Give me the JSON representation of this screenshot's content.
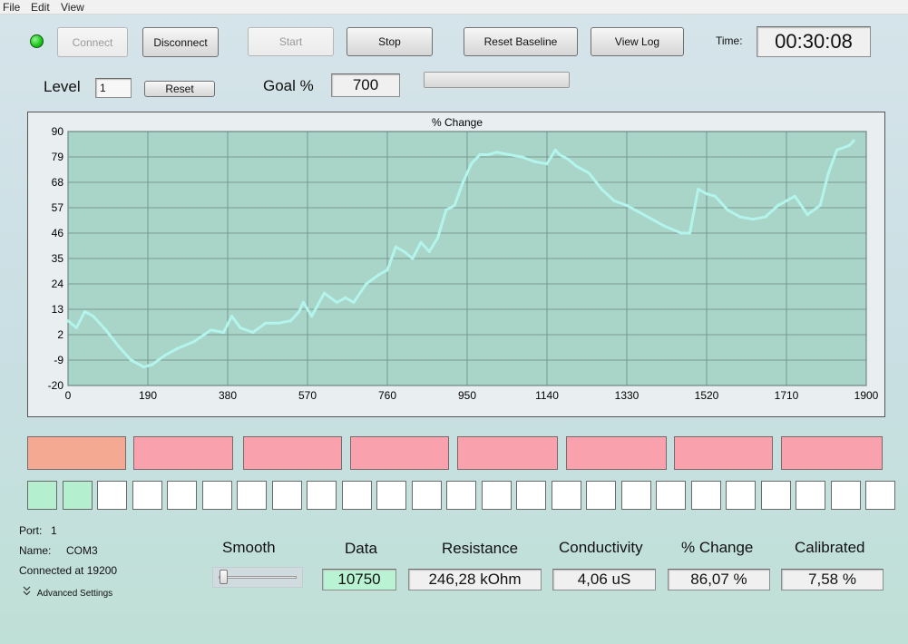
{
  "menu": [
    "File",
    "Edit",
    "View"
  ],
  "toolbar": {
    "connect_label": "Connect",
    "disconnect_label": "Disconnect",
    "start_label": "Start",
    "stop_label": "Stop",
    "reset_baseline_label": "Reset Baseline",
    "view_log_label": "View Log",
    "time_label": "Time:",
    "time_value": "00:30:08",
    "status_color": "#19c419"
  },
  "level": {
    "label": "Level",
    "value": "1",
    "reset_label": "Reset"
  },
  "goal": {
    "label": "Goal %",
    "value": "700",
    "progress": 0
  },
  "chart_data": {
    "type": "line",
    "title": "% Change",
    "xlabel": "",
    "ylabel": "",
    "xlim": [
      0,
      1900
    ],
    "ylim": [
      -20,
      90
    ],
    "x_ticks": [
      0,
      190,
      380,
      570,
      760,
      950,
      1140,
      1330,
      1520,
      1710,
      1900
    ],
    "y_ticks": [
      -20,
      -9,
      2,
      13,
      24,
      35,
      46,
      57,
      68,
      79,
      90
    ],
    "grid": true,
    "colors": {
      "plot_bg": "#a9d4c8",
      "line": "#b3f5ec",
      "grid": "#6b8a84"
    },
    "x": [
      0,
      20,
      40,
      60,
      90,
      120,
      150,
      180,
      200,
      230,
      260,
      300,
      340,
      370,
      390,
      410,
      440,
      470,
      500,
      530,
      550,
      560,
      580,
      610,
      640,
      660,
      680,
      710,
      740,
      760,
      780,
      800,
      820,
      840,
      860,
      880,
      900,
      920,
      940,
      960,
      980,
      1000,
      1020,
      1050,
      1080,
      1110,
      1140,
      1160,
      1170,
      1190,
      1210,
      1240,
      1270,
      1300,
      1330,
      1360,
      1390,
      1420,
      1460,
      1480,
      1500,
      1520,
      1540,
      1570,
      1600,
      1630,
      1660,
      1690,
      1710,
      1730,
      1760,
      1790,
      1810,
      1830,
      1860,
      1870
    ],
    "y": [
      8,
      5,
      12,
      10,
      4,
      -3,
      -9,
      -12,
      -11,
      -7,
      -4,
      -1,
      4,
      3,
      10,
      5,
      3,
      7,
      7,
      8,
      12,
      16,
      10,
      20,
      16,
      18,
      16,
      24,
      28,
      30,
      40,
      38,
      35,
      42,
      38,
      44,
      56,
      58,
      68,
      76,
      80,
      80,
      81,
      80,
      79,
      77,
      76,
      82,
      80,
      78,
      75,
      72,
      65,
      60,
      58,
      55,
      52,
      49,
      46,
      46,
      65,
      63,
      62,
      56,
      53,
      52,
      53,
      58,
      60,
      62,
      54,
      58,
      72,
      82,
      84,
      86
    ]
  },
  "level_blocks": [
    "#f4aa92",
    "#f9a2ae",
    "#f9a2ae",
    "#f9a2ae",
    "#f9a2ae",
    "#f9a2ae",
    "#f9a2ae",
    "#f9a2ae"
  ],
  "level_squares": {
    "count": 25,
    "filled": 2,
    "filled_color": "#b4f0cf",
    "empty_color": "#ffffff"
  },
  "port_info": {
    "port_label": "Port:",
    "port_value": "1",
    "name_label": "Name:",
    "name_value": "COM3",
    "connected_text": "Connected at 19200",
    "advanced_label": "Advanced Settings"
  },
  "smooth": {
    "label": "Smooth",
    "value": 0
  },
  "readouts": [
    {
      "label": "Data",
      "value": "10750",
      "highlight": "#b9f3d3"
    },
    {
      "label": "Resistance",
      "value": "246,28 kOhm"
    },
    {
      "label": "Conductivity",
      "value": "4,06 uS"
    },
    {
      "label": "% Change",
      "value": "86,07 %"
    },
    {
      "label": "Calibrated",
      "value": "7,58 %"
    }
  ]
}
